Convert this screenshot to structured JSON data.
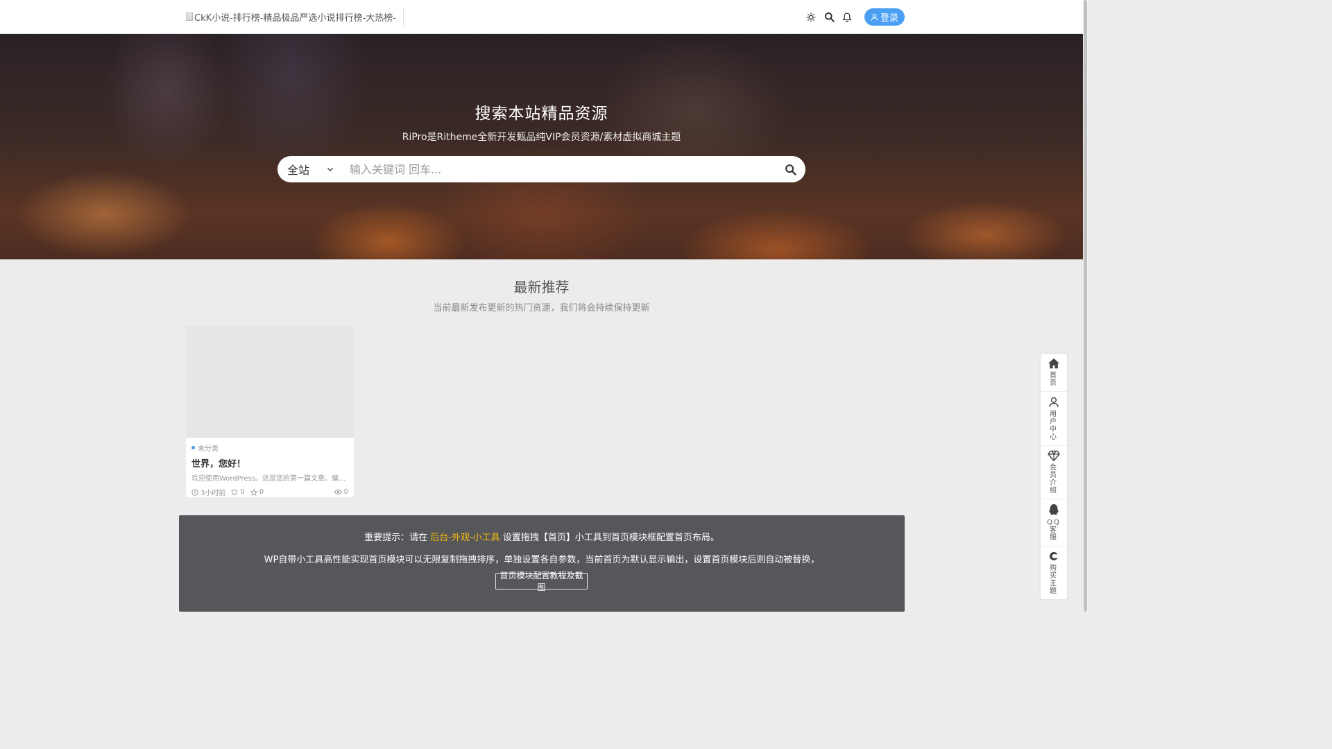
{
  "header": {
    "logo_alt": "CkK小说-排行榜-精品极品严选小说排行榜-大热榜-",
    "login_label": "登录"
  },
  "hero": {
    "title": "搜索本站精品资源",
    "subtitle": "RiPro是Ritheme全新开发甄品纯VIP会员资源/素材虚拟商城主题",
    "scope_selected": "全站",
    "search_placeholder": "输入关键词 回车..."
  },
  "section": {
    "title": "最新推荐",
    "subtitle": "当前最新发布更新的热门资源，我们将会持续保持更新"
  },
  "post": {
    "category": "未分类",
    "title": "世界，您好！",
    "excerpt": "欢迎使用WordPress。这是您的第一篇文章。编辑或删除它，然后开始写作吧！",
    "time": "3小时前",
    "likes": "0",
    "favorites": "0",
    "views": "0"
  },
  "notice": {
    "line1_prefix": "重要提示：请在",
    "line1_link": "后台-外观-小工具",
    "line1_suffix": "设置拖拽【首页】小工具到首页模块框配置首页布局。",
    "line2": "WP自带小工具高性能实现首页模块可以无限复制拖拽排序，单独设置各自参数，当前首页为默认显示输出，设置首页模块后则自动被替换，",
    "button": "首页模块配置教程及截图"
  },
  "float_bar": [
    {
      "label": "首页",
      "icon": "home-icon"
    },
    {
      "label": "用户中心",
      "icon": "user-icon"
    },
    {
      "label": "会员介绍",
      "icon": "diamond-icon"
    },
    {
      "label": "QQ客服",
      "icon": "qq-icon"
    },
    {
      "label": "购买主题",
      "icon": "buy-icon"
    }
  ],
  "colors": {
    "accent": "#4a9ff3",
    "link_highlight": "#f5b90f",
    "notice_bg": "#56575a"
  }
}
